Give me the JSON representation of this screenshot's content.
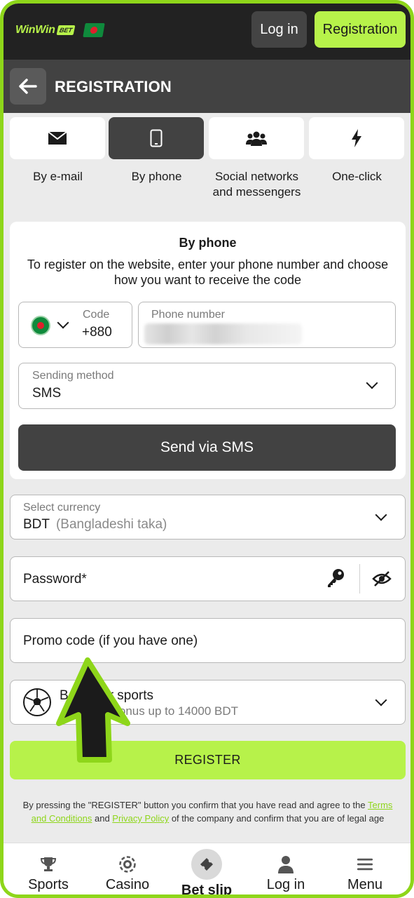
{
  "header": {
    "logo_text": "WinWin",
    "logo_badge": "BET",
    "login_label": "Log in",
    "register_label": "Registration"
  },
  "titlebar": {
    "title": "REGISTRATION"
  },
  "tabs": [
    {
      "label": "By e-mail",
      "icon": "envelope-icon"
    },
    {
      "label": "By phone",
      "icon": "smartphone-icon",
      "active": true
    },
    {
      "label": "Social networks and messengers",
      "icon": "people-icon"
    },
    {
      "label": "One-click",
      "icon": "lightning-icon"
    }
  ],
  "phone_card": {
    "title": "By phone",
    "description": "To register on the website, enter your phone number and choose how you want to receive the code",
    "code_label": "Code",
    "code_value": "+880",
    "phone_label": "Phone number",
    "sending_label": "Sending method",
    "sending_value": "SMS",
    "send_button": "Send via SMS"
  },
  "form": {
    "currency_label": "Select currency",
    "currency_code": "BDT",
    "currency_name": "(Bangladeshi taka)",
    "password_placeholder": "Password*",
    "promo_placeholder": "Promo code (if you have one)",
    "bonus_title_start": "B",
    "bonus_title_end": "r sports",
    "bonus_sub": "t bonus up to 14000 BDT",
    "register_button": "REGISTER"
  },
  "legal": {
    "part1": "By pressing the \"REGISTER\" button you confirm that you have read and agree to the ",
    "terms_link": "Terms and Conditions",
    "part2": " and ",
    "privacy_link": "Privacy Policy",
    "part3": " of the company and confirm that you are of legal age"
  },
  "bottom_nav": [
    {
      "label": "Sports",
      "icon": "trophy-icon"
    },
    {
      "label": "Casino",
      "icon": "chip-icon"
    },
    {
      "label": "Bet slip",
      "icon": "ticket-icon",
      "active": true
    },
    {
      "label": "Log in",
      "icon": "user-icon"
    },
    {
      "label": "Menu",
      "icon": "hamburger-icon"
    }
  ],
  "colors": {
    "accent": "#b7f24a",
    "frame": "#8ed61a",
    "dark": "#222222",
    "panel": "#424242"
  }
}
